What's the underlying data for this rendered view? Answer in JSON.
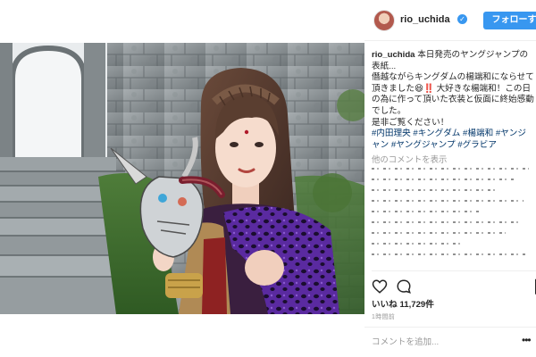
{
  "post": {
    "username": "rio_uchida",
    "follow_label": "フォローする",
    "caption": {
      "username": "rio_uchida",
      "text": "本日発売のヤングジャンプの表紙...\n僭越ながらキングダムの楊端和にならせて頂きました😆‼️ 大好きな楊端和！この日の為に作って頂いた衣装と仮面に終始感動でした。\n是非ご覧ください！",
      "hashtags": "#内田理央 #キングダム #楊端和 #ヤンジャン #ヤングジャンプ #グラビア"
    },
    "other_comments_label": "他のコメントを表示",
    "likes": {
      "label": "いいね",
      "count": "11,729件"
    },
    "time": "1時間前",
    "comment_placeholder": "コメントを追加...",
    "more_label": "•••"
  },
  "icons": {
    "verified": "verified-badge-icon",
    "like": "heart-icon",
    "comment": "comment-bubble-icon",
    "save": "bookmark-icon",
    "more": "more-dots-icon"
  },
  "colors": {
    "accent": "#3897f0",
    "hashtag": "#003569",
    "muted": "#999999",
    "text": "#262626"
  }
}
